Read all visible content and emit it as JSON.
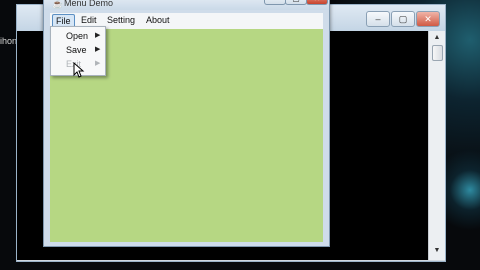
{
  "desktop": {
    "partial_label": "ihon."
  },
  "background_window": {
    "controls": [
      "–",
      "▢",
      "✕"
    ],
    "scroll_up": "▲",
    "scroll_down": "▼"
  },
  "app": {
    "title": "Menu Demo",
    "icon": "java-icon",
    "controls": [
      "–",
      "▢",
      "✕"
    ],
    "menubar": [
      "File",
      "Edit",
      "Setting",
      "About"
    ],
    "active_menu": "File",
    "client_color": "#b6d783",
    "file_menu": [
      {
        "label": "Open",
        "arrow": "▶",
        "enabled": true
      },
      {
        "label": "Save",
        "arrow": "▶",
        "enabled": true
      },
      {
        "label": "Exit",
        "arrow": "▶",
        "enabled": false
      }
    ]
  }
}
